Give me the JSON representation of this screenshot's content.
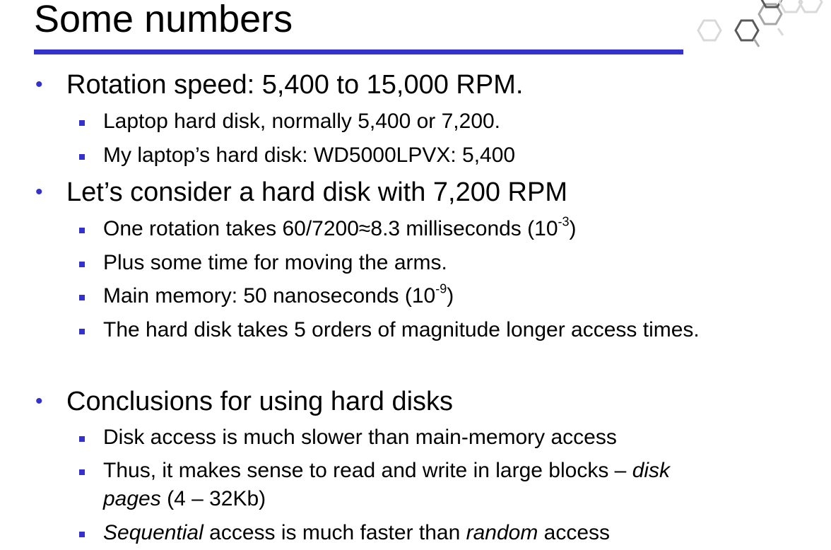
{
  "slide": {
    "title": "Some numbers",
    "accent_color": "#3333cc",
    "bullets": [
      {
        "text": "Rotation speed: 5,400 to 15,000 RPM.",
        "sub": [
          "Laptop hard disk, normally 5,400 or 7,200.",
          "My laptop’s hard disk: WD5000LPVX: 5,400"
        ]
      },
      {
        "text": "Let’s consider a hard disk with 7,200 RPM",
        "sub": [
          {
            "pre": "One rotation takes 60/7200≈8.3 milliseconds (10",
            "sup": "-3",
            "post": ")"
          },
          "Plus some time for moving the arms.",
          {
            "pre": "Main memory: 50 nanoseconds (10",
            "sup": "-9",
            "post": ")"
          },
          "The hard disk takes 5 orders of magnitude longer access times."
        ]
      },
      {
        "text": "Conclusions for using hard disks",
        "sub": [
          "Disk access is much slower than main-memory access",
          {
            "pre": "Thus, it makes sense to read and write in large blocks – ",
            "em": "disk",
            "line2_em": "pages",
            "line2_post": " (4 – 32Kb)"
          },
          {
            "em1": "Sequential",
            "mid": " access is much faster than ",
            "em2": "random",
            "post": " access"
          }
        ]
      }
    ]
  }
}
